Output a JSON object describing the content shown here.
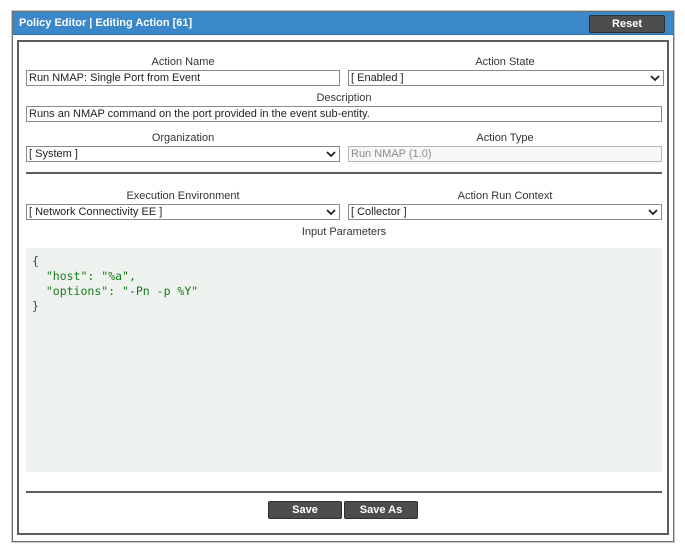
{
  "window": {
    "title": "Policy Editor | Editing Action [61]",
    "reset_label": "Reset"
  },
  "form": {
    "action_name": {
      "label": "Action Name",
      "value": "Run NMAP: Single Port from Event"
    },
    "action_state": {
      "label": "Action State",
      "value": "[ Enabled ]"
    },
    "description": {
      "label": "Description",
      "value": "Runs an NMAP command on the port provided in the event sub-entity."
    },
    "organization": {
      "label": "Organization",
      "value": "[ System ]"
    },
    "action_type": {
      "label": "Action Type",
      "value": "Run NMAP (1.0)"
    },
    "execution_environment": {
      "label": "Execution Environment",
      "value": "[ Network Connectivity EE ]"
    },
    "action_run_context": {
      "label": "Action Run Context",
      "value": "[ Collector ]"
    },
    "input_parameters": {
      "label": "Input Parameters",
      "open_brace": "{",
      "line1_key": "\"host\"",
      "line1_sep": ": ",
      "line1_val": "\"%a\",",
      "line2_key": "\"options\"",
      "line2_sep": ": ",
      "line2_val": "\"-Pn -p %Y\"",
      "close_brace": "}"
    }
  },
  "footer": {
    "save_label": "Save",
    "save_as_label": "Save As"
  },
  "colors": {
    "titlebar": "#3a87c9",
    "button": "#4d4d4d",
    "code_text": "#1a7a1a",
    "code_bg": "#eef2ee"
  }
}
